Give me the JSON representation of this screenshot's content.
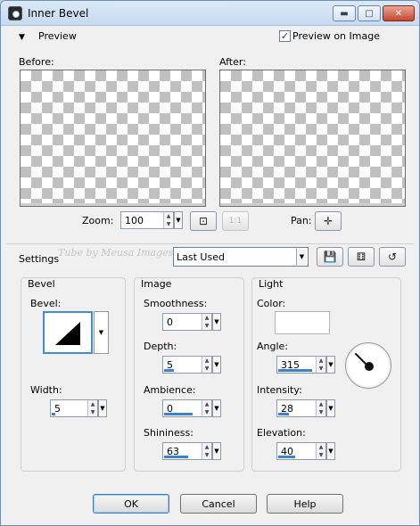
{
  "window": {
    "title": "Inner Bevel"
  },
  "window_buttons": {
    "minimize": "▬",
    "maximize": "□",
    "close": "✕"
  },
  "preview_section": {
    "collapse_glyph": "▼",
    "label": "Preview",
    "preview_on_image_label": "Preview on Image",
    "preview_on_image_checked": true,
    "check_glyph": "✓"
  },
  "before_label": "Before:",
  "after_label": "After:",
  "zoom": {
    "label": "Zoom:",
    "value": "100",
    "fit_icon": "center-view-icon",
    "one_to_one": "1:1"
  },
  "pan": {
    "label": "Pan:",
    "icon": "pan-cross-icon"
  },
  "settings": {
    "label": "Settings",
    "preset": "Last Used",
    "watermark": "Tube by Meusa Images"
  },
  "groups": {
    "bevel": {
      "title": "Bevel",
      "bevel_label": "Bevel:",
      "width_label": "Width:",
      "width_value": "5",
      "width_fill": 0.1
    },
    "image": {
      "title": "Image",
      "smoothness_label": "Smoothness:",
      "smoothness_value": "0",
      "smoothness_fill": 0.0,
      "depth_label": "Depth:",
      "depth_value": "5",
      "depth_fill": 0.25,
      "ambience_label": "Ambience:",
      "ambience_value": "0",
      "ambience_fill": 0.5,
      "shininess_label": "Shininess:",
      "shininess_value": "63",
      "shininess_fill": 0.63
    },
    "light": {
      "title": "Light",
      "color_label": "Color:",
      "color_value": "#ffffff",
      "angle_label": "Angle:",
      "angle_value": "315",
      "angle_fill": 0.875,
      "intensity_label": "Intensity:",
      "intensity_value": "28",
      "intensity_fill": 0.28,
      "elevation_label": "Elevation:",
      "elevation_value": "40",
      "elevation_fill": 0.44
    }
  },
  "buttons": {
    "ok": "OK",
    "cancel": "Cancel",
    "help": "Help"
  },
  "spin_glyphs": {
    "up": "▲",
    "down": "▼",
    "drop": "▼"
  }
}
